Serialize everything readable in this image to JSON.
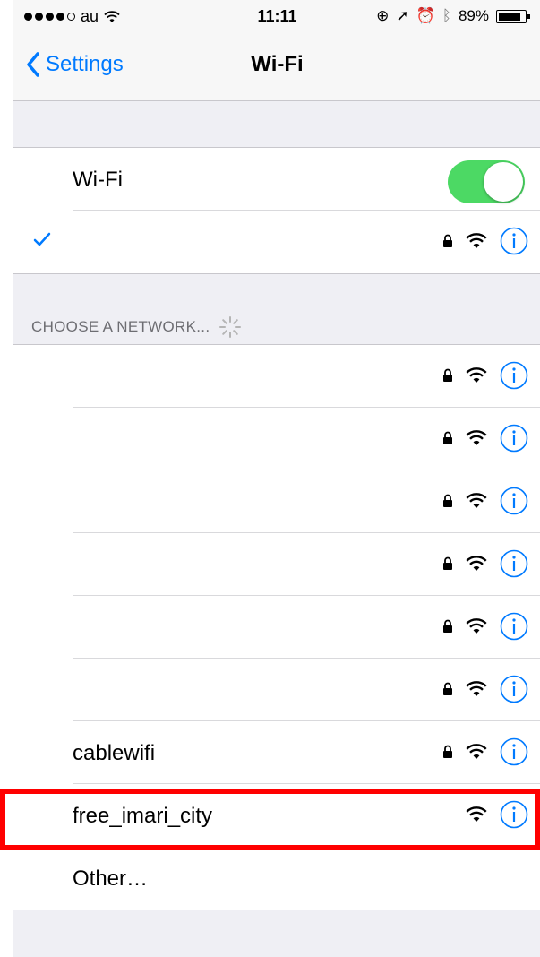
{
  "status_bar": {
    "carrier": "au",
    "time": "11:11",
    "battery": "89%",
    "battery_level": 0.89
  },
  "nav": {
    "back_label": "Settings",
    "title": "Wi-Fi"
  },
  "wifi_toggle": {
    "label": "Wi-Fi",
    "on": true
  },
  "section_header": "CHOOSE A NETWORK...",
  "networks": [
    {
      "name": "",
      "locked": true
    },
    {
      "name": "",
      "locked": true
    },
    {
      "name": "",
      "locked": true
    },
    {
      "name": "",
      "locked": true
    },
    {
      "name": "",
      "locked": true
    },
    {
      "name": "",
      "locked": true
    },
    {
      "name": "cablewifi",
      "locked": true
    },
    {
      "name": "free_imari_city",
      "locked": false
    }
  ],
  "other_label": "Other…",
  "icons": {
    "back": "chevron-left-icon",
    "check": "checkmark-icon",
    "lock": "lock-icon",
    "wifi": "wifi-icon",
    "info": "info-icon",
    "spinner": "spinner-icon"
  },
  "colors": {
    "accent": "#007aff",
    "toggle_on": "#4cd964",
    "highlight": "#ff0000"
  }
}
